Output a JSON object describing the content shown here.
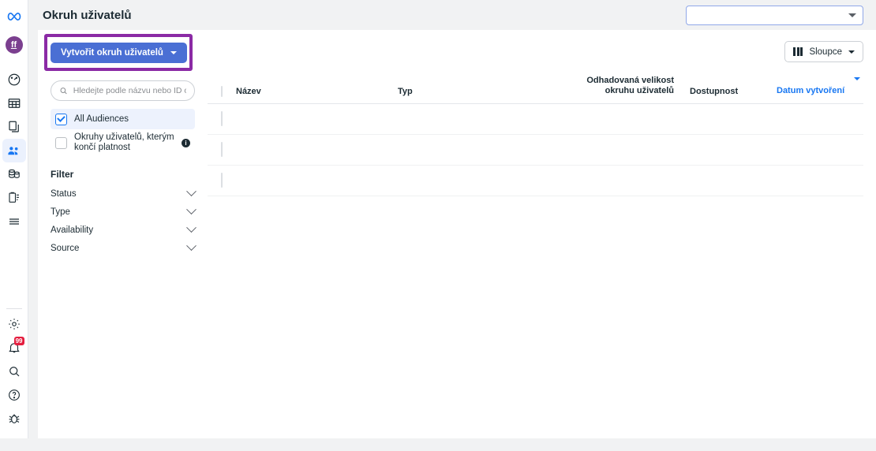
{
  "colors": {
    "brand_blue": "#1877f2",
    "button_blue": "#4a6fd4",
    "highlight_purple": "#8b2aa5",
    "badge_red": "#e41e3f",
    "avatar_purple": "#7b3f8f"
  },
  "rail": {
    "logo": "meta-infinity-logo",
    "avatar_initials": "ff",
    "items": [
      {
        "icon": "dashboard-gauge-icon",
        "active": false
      },
      {
        "icon": "table-grid-icon",
        "active": false
      },
      {
        "icon": "copy-pages-icon",
        "active": false
      },
      {
        "icon": "audiences-people-icon",
        "active": true
      },
      {
        "icon": "billing-coins-icon",
        "active": false
      },
      {
        "icon": "clipboard-list-icon",
        "active": false
      },
      {
        "icon": "hamburger-menu-icon",
        "active": false
      }
    ],
    "bottom_items": [
      {
        "icon": "gear-settings-icon",
        "badge": ""
      },
      {
        "icon": "bell-notifications-icon",
        "badge": "99"
      },
      {
        "icon": "search-icon",
        "badge": ""
      },
      {
        "icon": "help-question-icon",
        "badge": ""
      },
      {
        "icon": "bug-report-icon",
        "badge": ""
      }
    ]
  },
  "header": {
    "title": "Okruh uživatelů",
    "account_select_value": "",
    "account_select_icon": "chevron-down-icon"
  },
  "sidebar": {
    "create_button": {
      "label": "Vytvořit okruh uživatelů",
      "caret_icon": "chevron-down-icon"
    },
    "search": {
      "placeholder": "Hledejte podle názvu nebo ID o...",
      "value": "",
      "icon": "search-icon"
    },
    "audiences": [
      {
        "label": "All Audiences",
        "checked": true,
        "has_info": false
      },
      {
        "label": "Okruhy uživatelů, kterým končí platnost",
        "checked": false,
        "has_info": true
      }
    ],
    "filter_title": "Filter",
    "filters": [
      {
        "label": "Status",
        "icon": "chevron-down-icon"
      },
      {
        "label": "Type",
        "icon": "chevron-down-icon"
      },
      {
        "label": "Availability",
        "icon": "chevron-down-icon"
      },
      {
        "label": "Source",
        "icon": "chevron-down-icon"
      }
    ]
  },
  "table": {
    "columns_button": {
      "label": "Sloupce",
      "icon": "columns-icon",
      "caret_icon": "chevron-down-icon"
    },
    "headers": {
      "name": "Název",
      "type": "Typ",
      "size": "Odhadovaná velikost okruhu uživatelů",
      "availability": "Dostupnost",
      "date": "Datum vytvoření"
    },
    "sorted_column": "date",
    "sort_icon": "sort-descending-caret-icon",
    "rows": [
      {
        "name": "",
        "type": "",
        "size": "",
        "availability": "",
        "date": ""
      },
      {
        "name": "",
        "type": "",
        "size": "",
        "availability": "",
        "date": ""
      },
      {
        "name": "",
        "type": "",
        "size": "",
        "availability": "",
        "date": ""
      }
    ]
  }
}
